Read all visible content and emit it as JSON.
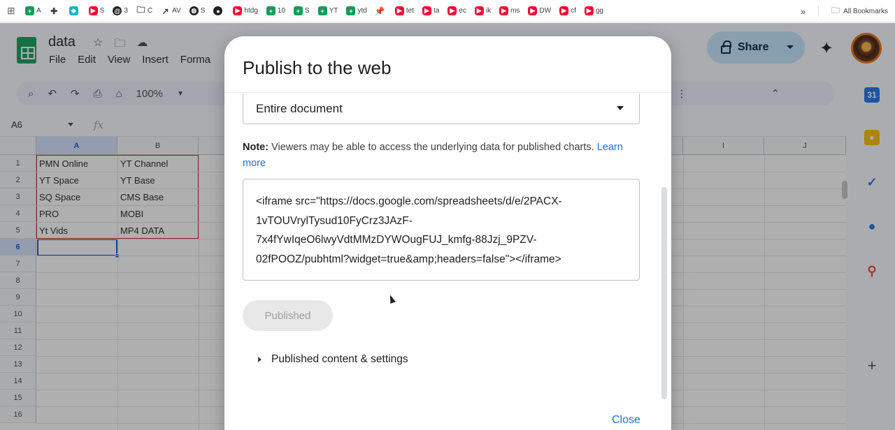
{
  "bookmarks": {
    "items": [
      {
        "label": "A",
        "icon": "sheets-icon"
      },
      {
        "label": "",
        "icon": "puzzle-icon"
      },
      {
        "label": "",
        "icon": "teal-app-icon"
      },
      {
        "label": "S",
        "icon": "youtube-icon"
      },
      {
        "label": "3",
        "icon": "threads-icon"
      },
      {
        "label": "C",
        "icon": "folder-icon"
      },
      {
        "label": "AV",
        "icon": "trend-icon"
      },
      {
        "label": "S",
        "icon": "globe-icon"
      },
      {
        "label": "",
        "icon": "github-icon"
      },
      {
        "label": "htdg",
        "icon": "youtube-icon"
      },
      {
        "label": "10",
        "icon": "sheets-icon"
      },
      {
        "label": "S",
        "icon": "sheets-icon"
      },
      {
        "label": "YT",
        "icon": "sheets-icon"
      },
      {
        "label": "ytd",
        "icon": "sheets-icon"
      },
      {
        "label": "",
        "icon": "pin-icon"
      },
      {
        "label": "tet",
        "icon": "youtube-icon"
      },
      {
        "label": "ta",
        "icon": "youtube-icon"
      },
      {
        "label": "ec",
        "icon": "youtube-icon"
      },
      {
        "label": "ik",
        "icon": "youtube-icon"
      },
      {
        "label": "ms",
        "icon": "youtube-icon"
      },
      {
        "label": "DW",
        "icon": "youtube-icon"
      },
      {
        "label": "cf",
        "icon": "youtube-icon"
      },
      {
        "label": "gg",
        "icon": "youtube-icon"
      }
    ],
    "overflow": "»",
    "all_bookmarks": "All Bookmarks"
  },
  "doc": {
    "title": "data",
    "menus": [
      "File",
      "Edit",
      "View",
      "Insert",
      "Forma"
    ],
    "zoom": "100%",
    "share_label": "Share"
  },
  "formula": {
    "cell_ref": "A6",
    "fx": "fx"
  },
  "grid": {
    "columns": [
      "A",
      "B",
      "I",
      "J"
    ],
    "rows": [
      "1",
      "2",
      "3",
      "4",
      "5",
      "6",
      "7",
      "8",
      "9",
      "10",
      "11",
      "12",
      "13",
      "14",
      "15",
      "16"
    ],
    "cells": [
      [
        "PMN Online",
        "YT Channel"
      ],
      [
        "YT Space",
        "YT Base"
      ],
      [
        "SQ Space",
        "CMS Base"
      ],
      [
        "PRO",
        "MOBI"
      ],
      [
        "Yt Vids",
        "MP4 DATA"
      ]
    ]
  },
  "dialog": {
    "title": "Publish to the web",
    "scope": "Entire document",
    "note_bold": "Note:",
    "note_text": " Viewers may be able to access the underlying data for published charts. ",
    "learn_more": "Learn more",
    "embed_lines": [
      "<iframe src=\"https://docs.google.com/spreadsheets/d/e/2PACX-",
      "1vTOUVrylTysud10FyCrz3JAzF-",
      "7x4fYwIqeO6lwyVdtMMzDYWOugFUJ_kmfg-88Jzj_9PZV-",
      "02fPOOZ/pubhtml?widget=true&amp;headers=false\"></iframe>"
    ],
    "published_label": "Published",
    "settings_label": "Published content & settings",
    "close_label": "Close"
  },
  "colors": {
    "accent": "#1a73e8",
    "share_bg": "#c2e7ff",
    "sheets_green": "#0f9d58",
    "selection": "#0b57d0",
    "range_border": "#c5221f"
  }
}
